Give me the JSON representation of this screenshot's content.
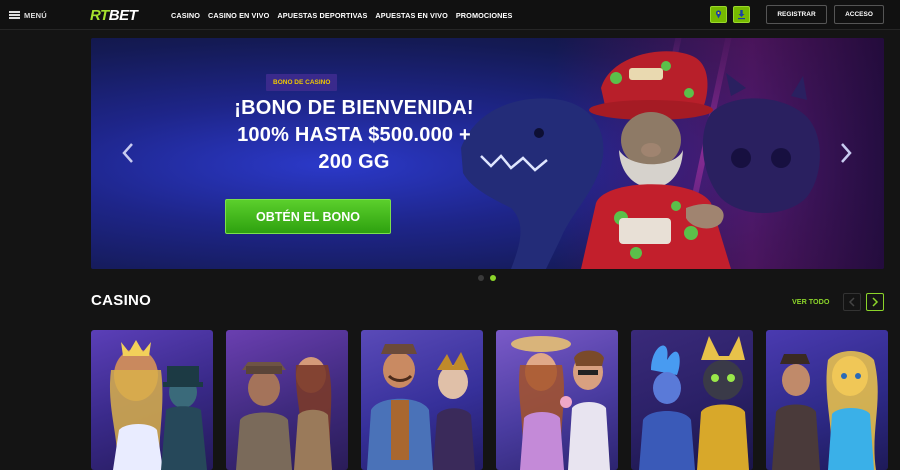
{
  "header": {
    "menu_label": "MENÚ",
    "logo": {
      "rt": "RT",
      "bet": "BET"
    },
    "nav": [
      {
        "label": "CASINO"
      },
      {
        "label": "CASINO EN VIVO"
      },
      {
        "label": "APUESTAS DEPORTIVAS"
      },
      {
        "label": "APUESTAS EN VIVO"
      },
      {
        "label": "PROMOCIONES"
      }
    ],
    "icons": [
      "map-pin-icon",
      "download-icon"
    ],
    "register_label": "REGISTRAR",
    "login_label": "ACCESO"
  },
  "banner": {
    "tag": "BONO DE CASINO",
    "title_line1": "¡BONO DE BIENVENIDA!",
    "title_line2": "100% HASTA $500.000 +",
    "title_line3": "200 GG",
    "cta": "OBTÉN EL BONO",
    "prev_icon": "chevron-left-icon",
    "next_icon": "chevron-right-icon",
    "slides": 2,
    "active_slide": 2
  },
  "casino": {
    "title": "CASINO",
    "see_all": "VER TODO",
    "games": [
      {
        "theme": "goddess-and-magician"
      },
      {
        "theme": "explorers"
      },
      {
        "theme": "mechanic-and-jester"
      },
      {
        "theme": "beach-couple"
      },
      {
        "theme": "egyptian-cat-and-genie"
      },
      {
        "theme": "wizard-and-sorceress"
      }
    ]
  },
  "colors": {
    "accent_green": "#8bd42a",
    "cta_green": "#3db71a",
    "tag_gold": "#f0c800",
    "banner_blue": "#1e2589",
    "background": "#141414"
  }
}
